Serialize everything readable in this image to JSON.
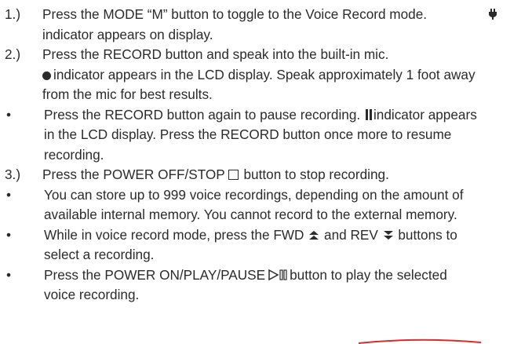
{
  "items": [
    {
      "marker": "1.)",
      "line1": "Press the MODE “M” button to toggle to the Voice Record mode.",
      "line2": "indicator appears on display."
    },
    {
      "marker": "2.)",
      "line1": "Press the RECORD button and speak into the built-in mic.",
      "line2_after_icon": "indicator appears in the LCD display. Speak approximately 1 foot away",
      "line3": "from the mic for best results."
    },
    {
      "marker": "•",
      "line1_before_icon": "Press the RECORD button again to pause recording.",
      "line1_after_icon": "indicator appears",
      "line2": "in the LCD display. Press the RECORD button once more to resume",
      "line3": "recording."
    },
    {
      "marker": "3.)",
      "line1_before_icon": "Press the POWER OFF/STOP",
      "line1_after_icon": "button to stop recording."
    },
    {
      "marker": "•",
      "line1": "You can store up to 999 voice recordings, depending on the amount of",
      "line2": "available internal memory.  You cannot record to the external memory."
    },
    {
      "marker": "•",
      "line1_before_fwd": "While in voice record mode, press the FWD",
      "line1_between": "and REV",
      "line1_after_rev": "buttons to",
      "line2": "select a recording."
    },
    {
      "marker": "•",
      "line1_before_icon": "Press the POWER ON/PLAY/PAUSE",
      "line1_after_icon": "button to play the selected",
      "line2": "voice recording."
    }
  ],
  "colors": {
    "text": "#2b2b2b",
    "annotation": "#d62d2d"
  },
  "icons": {
    "mic": "microphone-icon",
    "record": "record-dot-icon",
    "pause": "pause-bars-icon",
    "stop": "stop-square-icon",
    "fwd": "fwd-up-arrow-icon",
    "rev": "rev-down-arrow-icon",
    "play_pause": "play-pause-icon"
  }
}
